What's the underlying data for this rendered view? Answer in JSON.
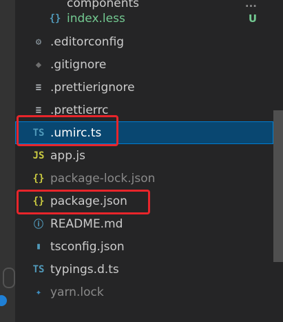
{
  "explorer": {
    "rows": [
      {
        "label": "components",
        "icon": "folder-icon",
        "glyph": "",
        "decoration": "..."
      },
      {
        "label": "index.less",
        "icon": "braces-icon",
        "glyph": "{}",
        "decoration": "U"
      },
      {
        "label": ".editorconfig",
        "icon": "gear-icon",
        "glyph": "⚙"
      },
      {
        "label": ".gitignore",
        "icon": "git-icon",
        "glyph": "◆"
      },
      {
        "label": ".prettierignore",
        "icon": "lines-icon",
        "glyph": "≡"
      },
      {
        "label": ".prettierrc",
        "icon": "lines-icon",
        "glyph": "≡"
      },
      {
        "label": ".umirc.ts",
        "icon": "typescript-icon",
        "glyph": "TS"
      },
      {
        "label": "app.js",
        "icon": "javascript-icon",
        "glyph": "JS"
      },
      {
        "label": "package-lock.json",
        "icon": "json-icon",
        "glyph": "{}"
      },
      {
        "label": "package.json",
        "icon": "json-icon",
        "glyph": "{}"
      },
      {
        "label": "README.md",
        "icon": "info-icon",
        "glyph": "ⓘ"
      },
      {
        "label": "tsconfig.json",
        "icon": "tsconfig-icon",
        "glyph": "▮"
      },
      {
        "label": "typings.d.ts",
        "icon": "typescript-icon",
        "glyph": "TS"
      },
      {
        "label": "yarn.lock",
        "icon": "yarn-icon",
        "glyph": "✦"
      }
    ]
  },
  "colors": {
    "sidebar_bg": "#252526",
    "selection_bg": "#094771",
    "highlight_box": "#e8252b",
    "untracked_green": "#73c991"
  }
}
